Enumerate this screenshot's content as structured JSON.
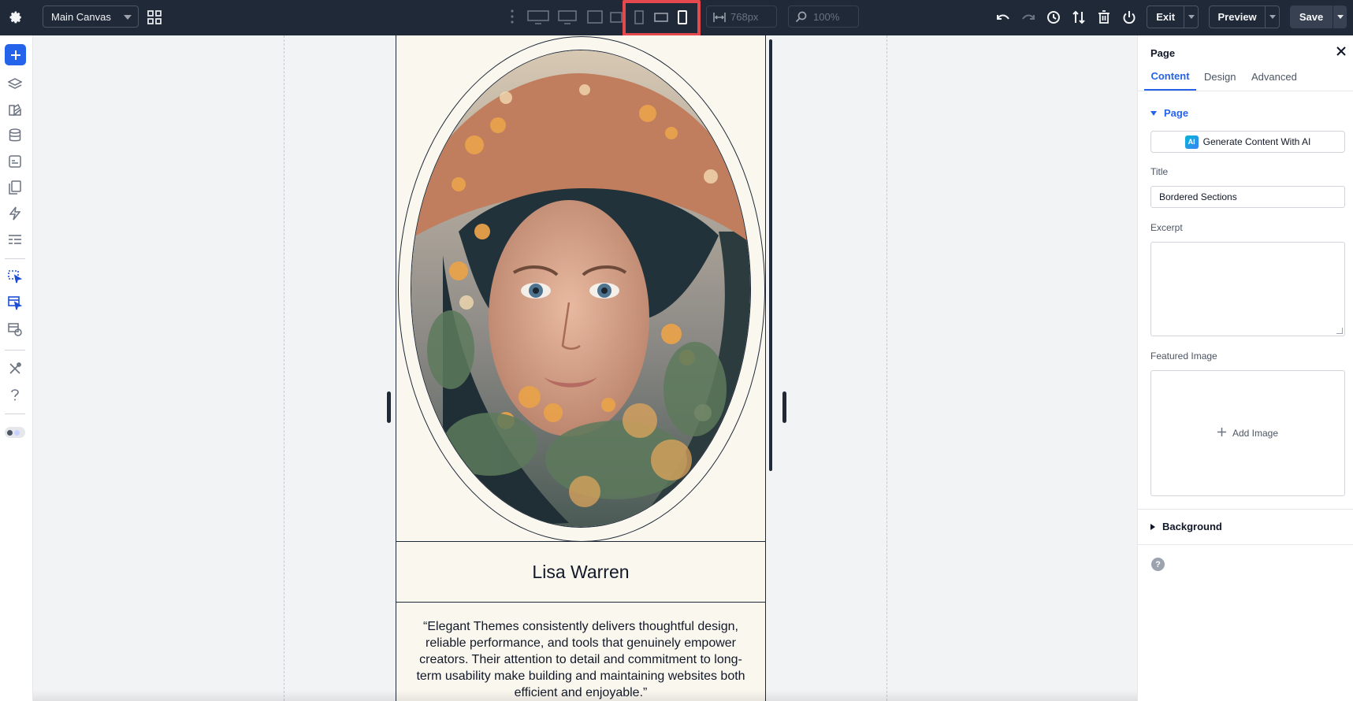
{
  "topbar": {
    "canvas_select": "Main Canvas",
    "width_value": "768px",
    "zoom_value": "100%",
    "exit_label": "Exit",
    "preview_label": "Preview",
    "save_label": "Save"
  },
  "page": {
    "name": "Lisa Warren",
    "quote": "“Elegant Themes consistently delivers thoughtful design, reliable performance, and tools that genuinely empower creators. Their attention to detail and commitment to long-term usability make building and maintaining websites both efficient and enjoyable.”"
  },
  "panel": {
    "title": "Page",
    "tabs": [
      "Content",
      "Design",
      "Advanced"
    ],
    "section_page": "Page",
    "ai_badge": "AI",
    "ai_button": "Generate Content With AI",
    "title_label": "Title",
    "title_value": "Bordered Sections",
    "excerpt_label": "Excerpt",
    "featured_label": "Featured Image",
    "add_image": "Add Image",
    "section_background": "Background",
    "help": "?"
  },
  "colors": {
    "topbar_bg": "#1f2937",
    "accent": "#2563eb",
    "highlight": "#e5484d",
    "page_bg": "#faf7ef"
  }
}
